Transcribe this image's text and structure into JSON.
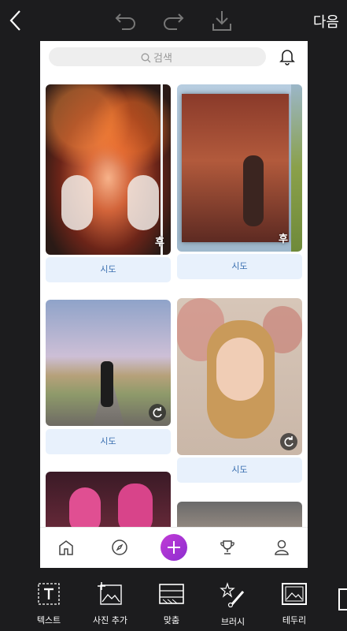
{
  "header": {
    "next_label": "다음",
    "icons": [
      "back-chevron-icon",
      "undo-icon",
      "redo-icon",
      "download-icon"
    ]
  },
  "search": {
    "placeholder": "검색"
  },
  "feed": {
    "cards": [
      {
        "badge": "후",
        "button": "시도"
      },
      {
        "badge": "후",
        "button": "시도"
      },
      {
        "badge": "",
        "button": "시도"
      },
      {
        "badge": "",
        "button": "시도"
      }
    ]
  },
  "bottom_nav": {
    "items": [
      "home-icon",
      "compass-icon",
      "plus-icon",
      "trophy-icon",
      "profile-icon"
    ],
    "accent": "#b136d4"
  },
  "toolbar": {
    "items": [
      {
        "label": "텍스트",
        "icon": "text-icon"
      },
      {
        "label": "사진 추가",
        "icon": "add-photo-icon"
      },
      {
        "label": "맞춤",
        "icon": "fit-icon"
      },
      {
        "label": "브러시",
        "icon": "brush-icon"
      },
      {
        "label": "테두리",
        "icon": "border-icon"
      }
    ]
  }
}
